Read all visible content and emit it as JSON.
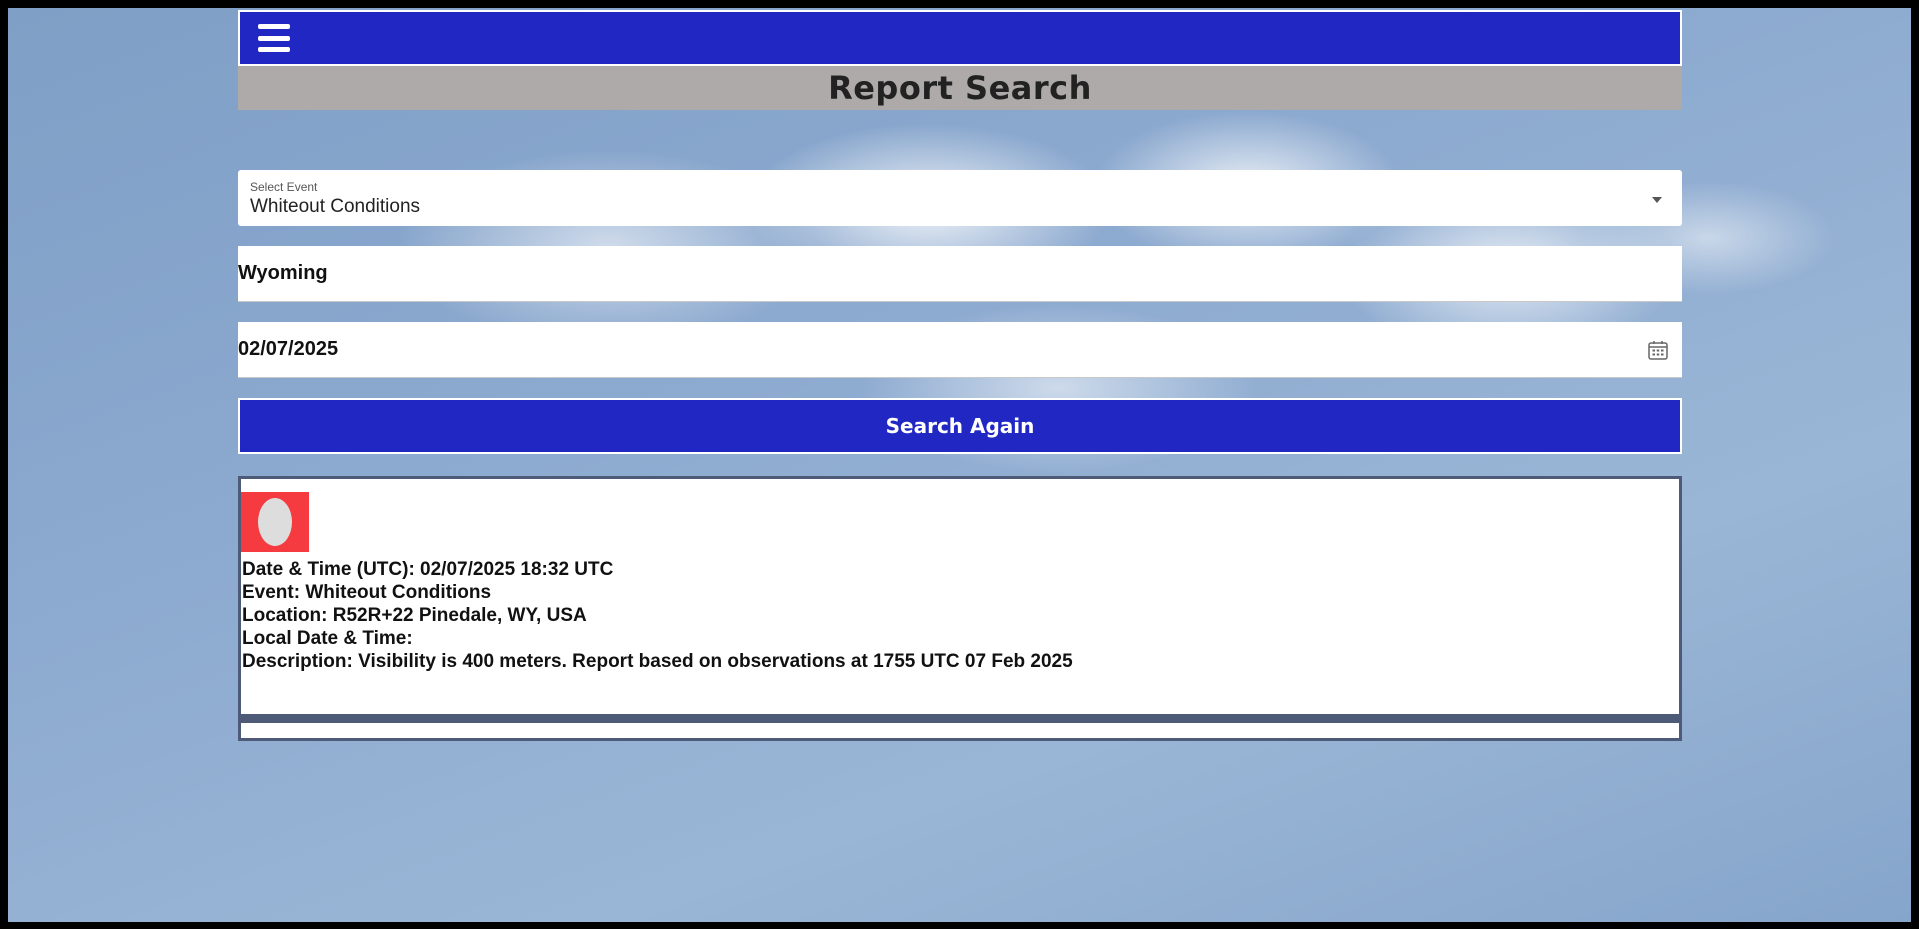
{
  "header": {
    "menu_icon": "hamburger-menu-icon",
    "title": "Report Search"
  },
  "form": {
    "event_label": "Select Event",
    "event_value": "Whiteout Conditions",
    "location_value": "Wyoming",
    "date_value": "02/07/2025",
    "calendar_icon": "calendar-icon",
    "search_button_label": "Search Again"
  },
  "result": {
    "datetime": "Date & Time (UTC): 02/07/2025 18:32 UTC",
    "event": "Event: Whiteout Conditions",
    "location": "Location: R52R+22 Pinedale, WY, USA",
    "local_datetime": "Local Date & Time:",
    "description": "Description: Visibility is 400 meters. Report based on observations at 1755 UTC 07 Feb 2025"
  },
  "colors": {
    "primary": "#2027c2",
    "title_bar": "#aeaaaa",
    "card_border": "#4e5b78",
    "thumb": "#f53b3f"
  }
}
